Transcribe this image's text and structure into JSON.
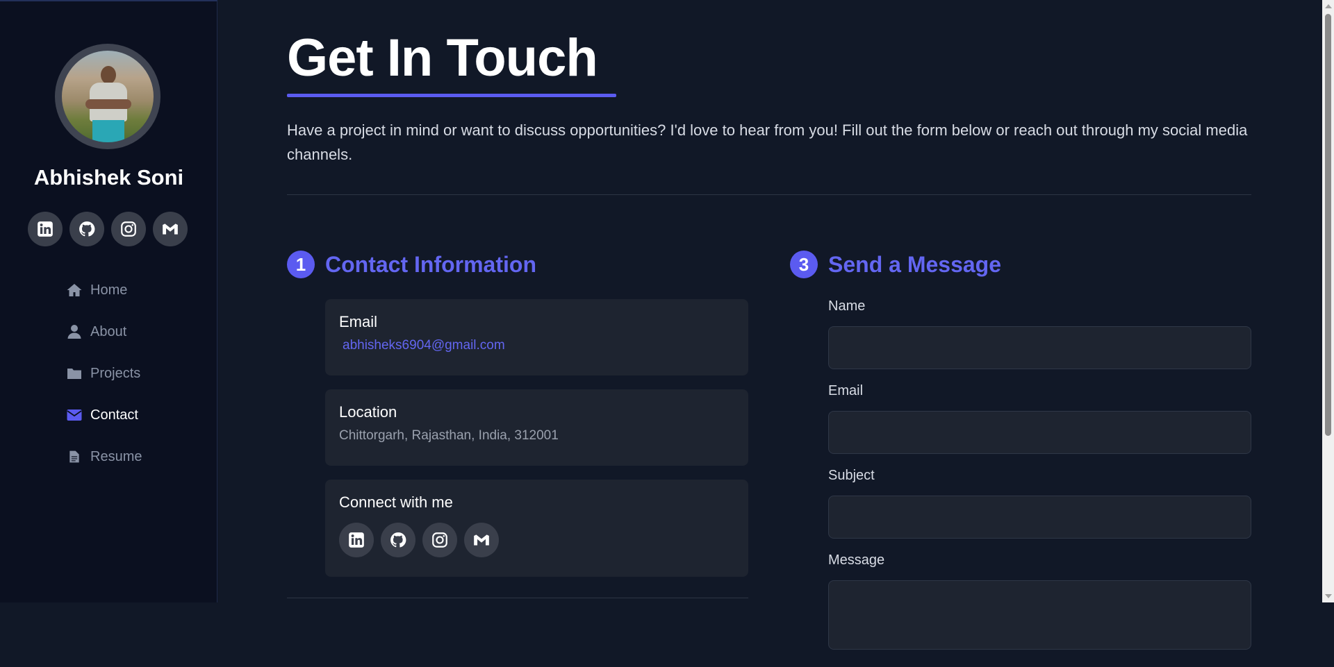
{
  "sidebar": {
    "name": "Abhishek Soni",
    "social": [
      {
        "icon": "linkedin-icon"
      },
      {
        "icon": "github-icon"
      },
      {
        "icon": "instagram-icon"
      },
      {
        "icon": "gmail-icon"
      }
    ],
    "nav": [
      {
        "label": "Home",
        "icon": "home-icon"
      },
      {
        "label": "About",
        "icon": "user-icon"
      },
      {
        "label": "Projects",
        "icon": "folder-icon"
      },
      {
        "label": "Contact",
        "icon": "envelope-icon",
        "active": true
      },
      {
        "label": "Resume",
        "icon": "document-icon"
      }
    ]
  },
  "main": {
    "title": "Get In Touch",
    "intro": "Have a project in mind or want to discuss opportunities? I'd love to hear from you! Fill out the form below or reach out through my social media channels.",
    "contact_section": {
      "number": "1",
      "title": "Contact Information",
      "email_label": "Email",
      "email_value": "abhisheks6904@gmail.com",
      "location_label": "Location",
      "location_value": "Chittorgarh, Rajasthan, India, 312001",
      "connect_label": "Connect with me"
    },
    "message_section": {
      "number": "3",
      "title": "Send a Message",
      "name_label": "Name",
      "email_label": "Email",
      "subject_label": "Subject",
      "message_label": "Message"
    }
  },
  "colors": {
    "accent": "#6366f1",
    "background": "#111827",
    "sidebar": "#0b1020",
    "card": "#1e2430"
  }
}
